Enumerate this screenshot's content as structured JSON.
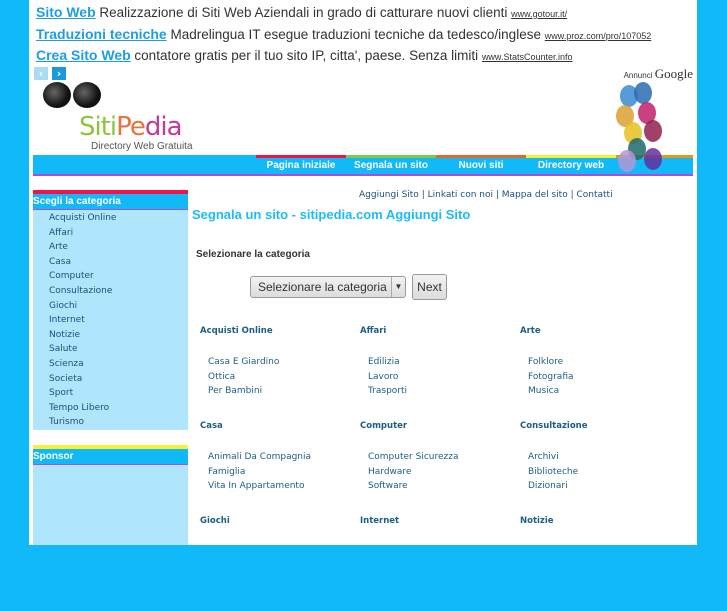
{
  "ads": [
    {
      "title": "Sito Web",
      "text": "Realizzazione di Siti Web Aziendali in grado di catturare nuovi clienti",
      "url": "www.gotour.it/"
    },
    {
      "title": "Traduzioni tecniche",
      "text": "Madrelingua IT esegue traduzioni tecniche da tedesco/inglese",
      "url": "www.proz.com/pro/107052"
    },
    {
      "title": "Crea Sito Web",
      "text": "contatore gratis per il tuo sito IP, citta', paese. Senza limiti",
      "url": "www.StatsCounter.info"
    }
  ],
  "ad_label": "Annunci",
  "ad_brand": "Google",
  "logo": {
    "name": "SitiPedia",
    "tagline": "Directory Web Gratuita"
  },
  "nav": [
    {
      "label": "Pagina iniziale",
      "color": "#f0144c"
    },
    {
      "label": "Segnala un sito",
      "color": "#7ccc4a"
    },
    {
      "label": "Nuovi siti",
      "color": "#e06a28"
    },
    {
      "label": "Directory web",
      "color": "#f8f030"
    }
  ],
  "sidebar": {
    "title": "Scegli la categoria",
    "items": [
      "Acquisti Online",
      "Affari",
      "Arte",
      "Casa",
      "Computer",
      "Consultazione",
      "Giochi",
      "Internet",
      "Notizie",
      "Salute",
      "Scienza",
      "Societa",
      "Sport",
      "Tempo Libero",
      "Turismo"
    ],
    "sponsor_title": "Sponsor"
  },
  "toplinks": [
    "Aggiungi Sito",
    "Linkati con noi",
    "Mappa del sito",
    "Contatti"
  ],
  "main": {
    "title": "Segnala un sito - sitipedia.com Aggiungi Sito",
    "select_label": "Selezionare la categoria",
    "select_value": "Selezionare la categoria",
    "next_label": "Next"
  },
  "categories": [
    {
      "name": "Acquisti Online",
      "subs": [
        "Casa E Giardino",
        "Ottica",
        "Per Bambini"
      ]
    },
    {
      "name": "Affari",
      "subs": [
        "Edilizia",
        "Lavoro",
        "Trasporti"
      ]
    },
    {
      "name": "Arte",
      "subs": [
        "Folklore",
        "Fotografia",
        "Musica"
      ]
    },
    {
      "name": "Casa",
      "subs": [
        "Animali Da Compagnia",
        "Famiglia",
        "Vita In Appartamento"
      ]
    },
    {
      "name": "Computer",
      "subs": [
        "Computer Sicurezza",
        "Hardware",
        "Software"
      ]
    },
    {
      "name": "Consultazione",
      "subs": [
        "Archivi",
        "Biblioteche",
        "Dizionari"
      ]
    },
    {
      "name": "Giochi",
      "subs": []
    },
    {
      "name": "Internet",
      "subs": []
    },
    {
      "name": "Notizie",
      "subs": []
    }
  ]
}
